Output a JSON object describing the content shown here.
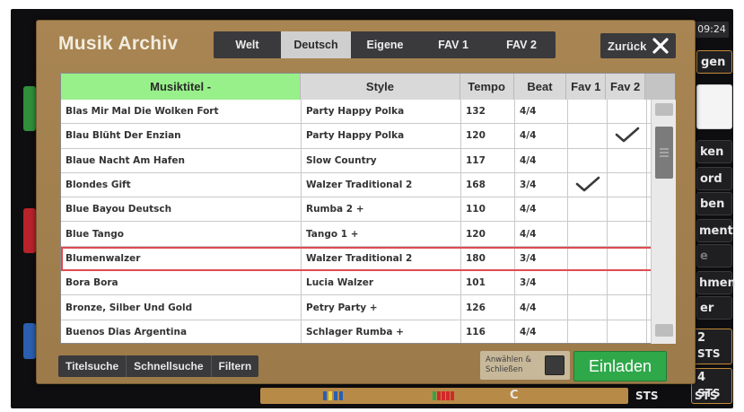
{
  "background": {
    "clock": "09:24",
    "side_labels": [
      "gen",
      "ken",
      "ord",
      "ben",
      "ment",
      "e",
      "hmen",
      "er"
    ],
    "lower_right": [
      {
        "num": "2",
        "label": "STS"
      },
      {
        "num": "4",
        "label": "STS"
      }
    ],
    "bottom_labels": [
      "C",
      "STS",
      "STS"
    ]
  },
  "dialog": {
    "title": "Musik Archiv",
    "tabs": [
      {
        "label": "Welt",
        "active": false
      },
      {
        "label": "Deutsch",
        "active": true
      },
      {
        "label": "Eigene",
        "active": false
      },
      {
        "label": "FAV 1",
        "active": false
      },
      {
        "label": "FAV 2",
        "active": false
      }
    ],
    "back_label": "Zurück"
  },
  "table": {
    "headers": [
      "Musiktitel -",
      "Style",
      "Tempo",
      "Beat",
      "Fav 1",
      "Fav 2"
    ],
    "sorted_column": 0,
    "selected_row": 6,
    "rows": [
      {
        "title": "Blas Mir Mal Die Wolken Fort",
        "style": "Party Happy Polka",
        "tempo": "132",
        "beat": "4/4",
        "fav1": false,
        "fav2": false
      },
      {
        "title": "Blau Blüht Der Enzian",
        "style": "Party Happy Polka",
        "tempo": "120",
        "beat": "4/4",
        "fav1": false,
        "fav2": true
      },
      {
        "title": "Blaue Nacht Am Hafen",
        "style": "Slow Country",
        "tempo": "117",
        "beat": "4/4",
        "fav1": false,
        "fav2": false
      },
      {
        "title": "Blondes Gift",
        "style": "Walzer Traditional 2",
        "tempo": "168",
        "beat": "3/4",
        "fav1": true,
        "fav2": false
      },
      {
        "title": "Blue Bayou Deutsch",
        "style": "Rumba 2 +",
        "tempo": "110",
        "beat": "4/4",
        "fav1": false,
        "fav2": false
      },
      {
        "title": "Blue Tango",
        "style": "Tango 1 +",
        "tempo": "120",
        "beat": "4/4",
        "fav1": false,
        "fav2": false
      },
      {
        "title": "Blumenwalzer",
        "style": "Walzer Traditional 2",
        "tempo": "180",
        "beat": "3/4",
        "fav1": false,
        "fav2": false
      },
      {
        "title": "Bora Bora",
        "style": "Lucia Walzer",
        "tempo": "101",
        "beat": "3/4",
        "fav1": false,
        "fav2": false
      },
      {
        "title": "Bronze, Silber Und Gold",
        "style": "Petry Party +",
        "tempo": "126",
        "beat": "4/4",
        "fav1": false,
        "fav2": false
      },
      {
        "title": "Buenos Dias Argentina",
        "style": "Schlager Rumba +",
        "tempo": "116",
        "beat": "4/4",
        "fav1": false,
        "fav2": false
      }
    ]
  },
  "footer": {
    "tools": [
      "Titelsuche",
      "Schnellsuche",
      "Filtern"
    ],
    "select_close_label": "Anwählen & Schließen",
    "load_label": "Einladen"
  },
  "colors": {
    "dialog_bg": "#a88552",
    "sorted_header": "#98f08a",
    "selected_outline": "#e04a52",
    "load_button": "#2fa84a"
  }
}
